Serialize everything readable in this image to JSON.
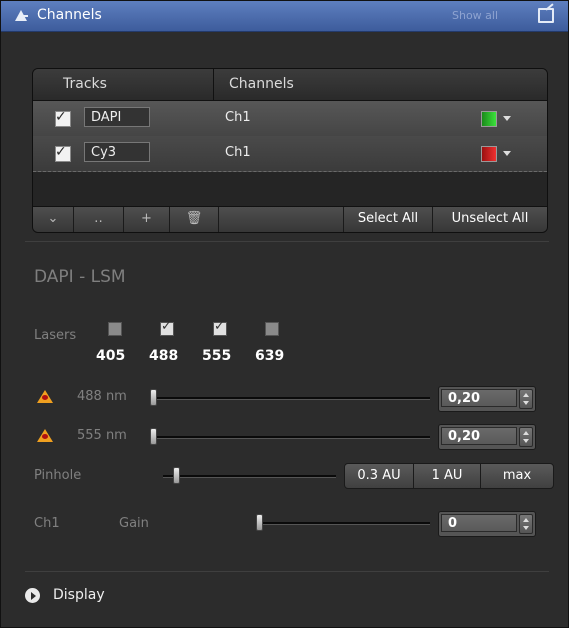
{
  "panel": {
    "title": "Channels",
    "show_all": "Show all"
  },
  "tracks_table": {
    "headers": [
      "Tracks",
      "Channels"
    ],
    "rows": [
      {
        "checked": true,
        "track": "DAPI",
        "channel": "Ch1",
        "color": "#2dbb2d"
      },
      {
        "checked": true,
        "track": "Cy3",
        "channel": "Ch1",
        "color": "#d81e1e"
      }
    ],
    "toolbar": {
      "add": "+",
      "select_all": "Select All",
      "unselect_all": "Unselect All"
    }
  },
  "track_settings": {
    "title": "DAPI - LSM",
    "lasers_label": "Lasers",
    "lasers": [
      {
        "wavelength": "405",
        "checked": false
      },
      {
        "wavelength": "488",
        "checked": true
      },
      {
        "wavelength": "555",
        "checked": true
      },
      {
        "wavelength": "639",
        "checked": false
      }
    ],
    "laser_power": [
      {
        "label": "488 nm",
        "value": "0,20"
      },
      {
        "label": "555 nm",
        "value": "0,20"
      }
    ],
    "pinhole": {
      "label": "Pinhole",
      "buttons": [
        "0.3 AU",
        "1 AU",
        "max"
      ]
    },
    "channel": {
      "name": "Ch1",
      "gain_label": "Gain",
      "gain_value": "0"
    }
  },
  "display": {
    "label": "Display"
  }
}
